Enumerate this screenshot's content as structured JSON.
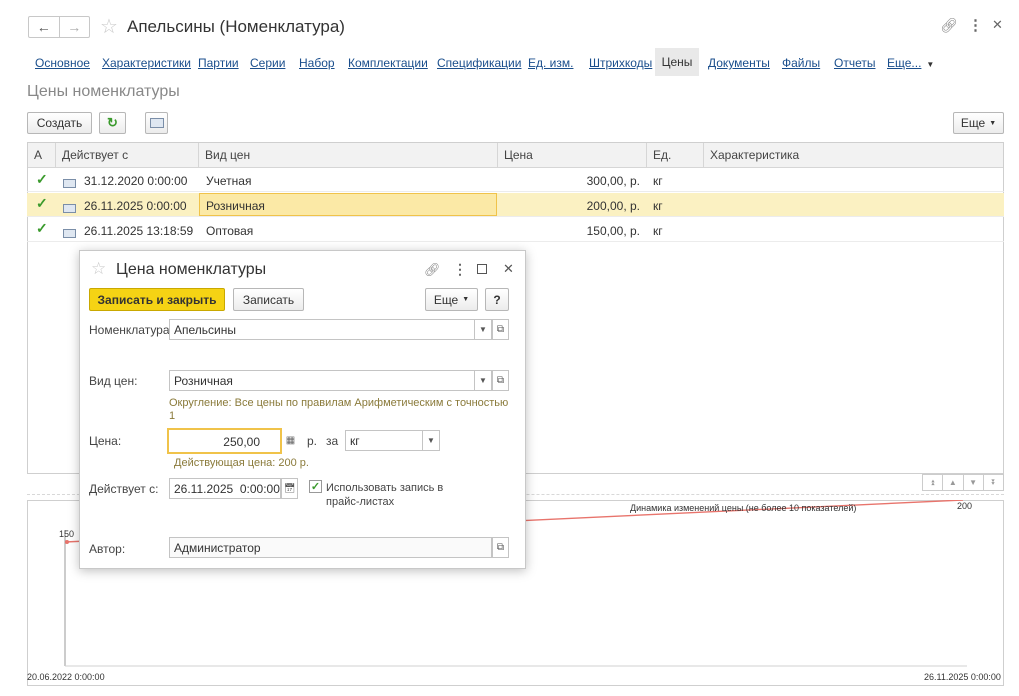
{
  "window": {
    "title": "Апельсины (Номенклатура)",
    "nav_back": "←",
    "nav_forward": "→"
  },
  "tabs": [
    {
      "label": "Основное"
    },
    {
      "label": "Характеристики"
    },
    {
      "label": "Партии"
    },
    {
      "label": "Серии"
    },
    {
      "label": "Набор"
    },
    {
      "label": "Комплектации"
    },
    {
      "label": "Спецификации"
    },
    {
      "label": "Ед. изм."
    },
    {
      "label": "Штрихкоды"
    },
    {
      "label": "Цены"
    },
    {
      "label": "Документы"
    },
    {
      "label": "Файлы"
    },
    {
      "label": "Отчеты"
    },
    {
      "label": "Еще..."
    }
  ],
  "section_title": "Цены номенклатуры",
  "toolbar": {
    "create_label": "Создать",
    "more_label": "Еще"
  },
  "table": {
    "columns": [
      "А",
      "Действует с",
      "Вид цен",
      "Цена",
      "Ед.",
      "Характеристика"
    ],
    "rows": [
      {
        "date": "31.12.2020 0:00:00",
        "price_type": "Учетная",
        "price": "300,00, р.",
        "unit": "кг",
        "characteristic": ""
      },
      {
        "date": "26.11.2025 0:00:00",
        "price_type": "Розничная",
        "price": "200,00, р.",
        "unit": "кг",
        "characteristic": ""
      },
      {
        "date": "26.11.2025 13:18:59",
        "price_type": "Оптовая",
        "price": "150,00, р.",
        "unit": "кг",
        "characteristic": ""
      }
    ]
  },
  "chart": {
    "title": "Динамика изменений цены (не более 10 показателей)",
    "first_value_label": "150",
    "last_value_label": "200",
    "x_start": "20.06.2022 0:00:00",
    "x_end": "26.11.2025 0:00:00",
    "line_color": "#e8746c"
  },
  "dialog": {
    "title": "Цена номенклатуры",
    "save_close_label": "Записать и закрыть",
    "save_label": "Записать",
    "more_label": "Еще",
    "help_label": "?",
    "nomenclature_label": "Номенклатура:",
    "nomenclature_value": "Апельсины",
    "price_type_label": "Вид цен:",
    "price_type_value": "Розничная",
    "rounding_note": "Округление: Все цены по правилам Арифметическим с точностью 1",
    "price_label": "Цена:",
    "price_value": "250,00",
    "currency_label": "р.",
    "per_label": "за",
    "unit_value": "кг",
    "current_price_note": "Действующая цена: 200 р.",
    "valid_from_label": "Действует с:",
    "valid_from_value": "26.11.2025  0:00:00",
    "use_in_pricelist_label": "Использовать запись в прайс-листах",
    "use_in_pricelist_checked": true,
    "author_label": "Автор:",
    "author_value": "Администратор"
  },
  "colors": {
    "accent_yellow": "#f5d314",
    "selected_row": "#fbf1c2",
    "link_blue": "#1a4e8c",
    "check_green": "#3a9a2c",
    "note_olive": "#8a7a3a"
  }
}
